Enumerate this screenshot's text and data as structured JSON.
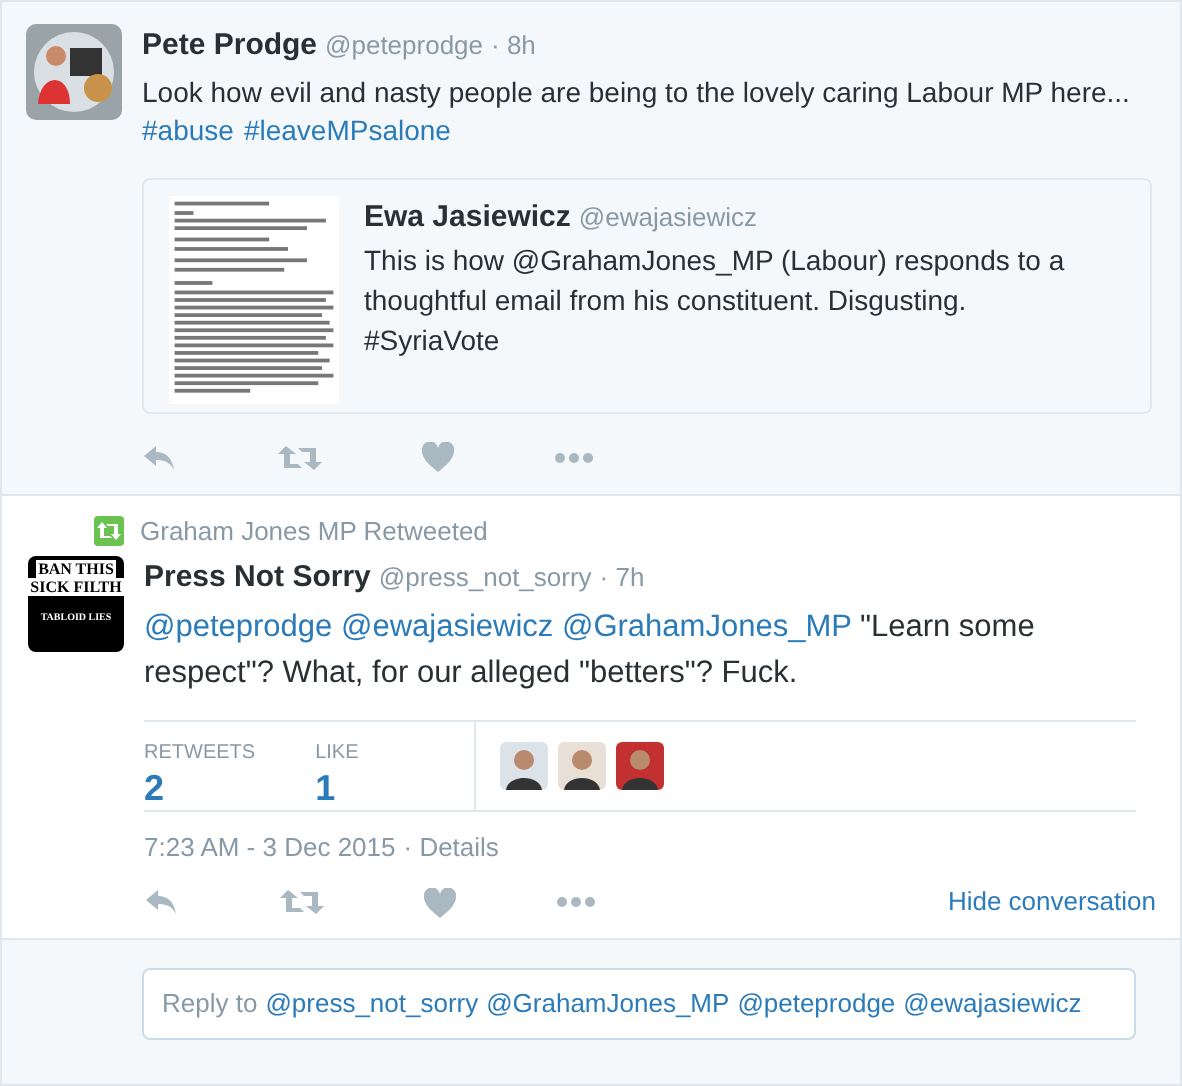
{
  "parent_tweet": {
    "name": "Pete Prodge",
    "handle": "@peteprodge",
    "time": "· 8h",
    "text": "Look how evil and nasty people are being to the lovely caring Labour MP here...",
    "hashtags": [
      "#abuse",
      "#leaveMPsalone"
    ],
    "quote": {
      "kind": "picture",
      "name": "Ewa Jasiewicz",
      "handle": "@ewajasiewicz",
      "text": "This is how @GrahamJones_MP (Labour) responds to a thoughtful email from his constituent. Disgusting. #SyriaVote"
    }
  },
  "retweet_note": "Graham Jones MP Retweeted",
  "tweet": {
    "name": "Press Not Sorry",
    "handle": "@press_not_sorry",
    "time": "· 7h",
    "avatar_lines": [
      "BAN THIS",
      "SICK FILTH",
      "TABLOID LIES"
    ],
    "mentions": [
      "@peteprodge",
      "@ewajasiewicz",
      "@GrahamJones_MP"
    ],
    "text": "\"Learn some respect\"? What, for our alleged \"betters\"? Fuck.",
    "stats": [
      {
        "label": "RETWEETS",
        "value": "2"
      },
      {
        "label": "LIKE",
        "value": "1"
      }
    ],
    "likers": [
      {
        "kind": "person",
        "color": "#dbe3e8"
      },
      {
        "kind": "person",
        "color": "#e8e0d6"
      },
      {
        "kind": "person",
        "color": "#c23030"
      }
    ],
    "timestamp": "7:23 AM - 3 Dec 2015",
    "details": "· Details",
    "hide": "Hide conversation"
  },
  "reply": {
    "prefix": "Reply to",
    "mentions": [
      "@press_not_sorry",
      "@GrahamJones_MP",
      "@peteprodge",
      "@ewajasiewicz"
    ]
  }
}
